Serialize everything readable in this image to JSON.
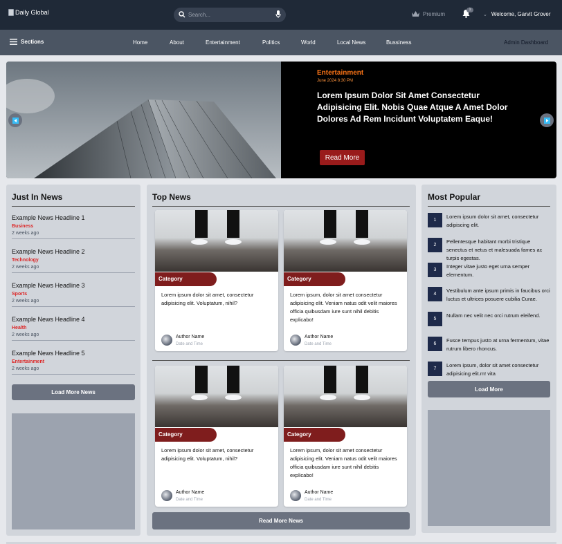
{
  "header": {
    "logo_alt": "Daily Global",
    "search_placeholder": "Search...",
    "premium_label": "Premium",
    "notification_count": "1",
    "welcome_text": "Welcome, Garvit Grover"
  },
  "nav": {
    "sections_label": "Sections",
    "links": [
      "Home",
      "About",
      "Entertainment",
      "Politics",
      "World",
      "Local News",
      "Bussiness"
    ],
    "admin_label": "Admin Dashboard"
  },
  "hero": {
    "category": "Entertainment",
    "date": "June 2024 8:30 PM",
    "headline": "Lorem Ipsum Dolor Sit Amet Consectetur Adipisicing Elit. Nobis Quae Atque A Amet Dolor Dolores Ad Rem Incidunt Voluptatem Eaque!",
    "read_more": "Read More"
  },
  "just_in": {
    "title": "Just In News",
    "items": [
      {
        "headline": "Example News Headline 1",
        "category": "Business",
        "time": "2 weeks ago"
      },
      {
        "headline": "Example News Headline 2",
        "category": "Technology",
        "time": "2 weeks ago"
      },
      {
        "headline": "Example News Headline 3",
        "category": "Sports",
        "time": "2 weeks ago"
      },
      {
        "headline": "Example News Headline 4",
        "category": "Health",
        "time": "2 weeks ago"
      },
      {
        "headline": "Example News Headline 5",
        "category": "Entertainment",
        "time": "2 weeks ago"
      }
    ],
    "load_more": "Load More News"
  },
  "top_news": {
    "title": "Top News",
    "cards": [
      {
        "category": "Category",
        "body": "Lorem ipsum dolor sit amet, consectetur adipisicing elit. Voluptatum, nihil?",
        "author": "Author Name",
        "date": "Date and Time"
      },
      {
        "category": "Category",
        "body": "Lorem ipsum, dolor sit amet consectetur adipisicing elit. Veniam natus odit velit maiores officia quibusdam iure sunt nihil debitis explicabo!",
        "author": "Author Name",
        "date": "Date and Time"
      },
      {
        "category": "Category",
        "body": "Lorem ipsum dolor sit amet, consectetur adipisicing elit. Voluptatum, nihil?",
        "author": "Author Name",
        "date": "Date and Time"
      },
      {
        "category": "Category",
        "body": "Lorem ipsum, dolor sit amet consectetur adipisicing elit. Veniam natus odit velit maiores officia quibusdam iure sunt nihil debitis explicabo!",
        "author": "Author Name",
        "date": "Date and Time"
      }
    ],
    "read_more": "Read More News"
  },
  "most_popular": {
    "title": "Most Popular",
    "items": [
      {
        "num": "1",
        "text": "Lorem ipsum dolor sit amet, consectetur adipiscing elit."
      },
      {
        "num": "2",
        "text": "Pellentesque habitant morbi tristique senectus et netus et malesuada fames ac turpis egestas."
      },
      {
        "num": "3",
        "text": "Integer vitae justo eget urna semper elementum."
      },
      {
        "num": "4",
        "text": "Vestibulum ante ipsum primis in faucibus orci luctus et ultrices posuere cubilia Curae."
      },
      {
        "num": "5",
        "text": "Nullam nec velit nec orci rutrum eleifend."
      },
      {
        "num": "6",
        "text": "Fusce tempus justo at urna fermentum, vitae rutrum libero rhoncus."
      },
      {
        "num": "7",
        "text": "Lorem ipsum, dolor sit amet consectetur adipisicing elit.m! vita"
      }
    ],
    "load_more": "Load More"
  }
}
